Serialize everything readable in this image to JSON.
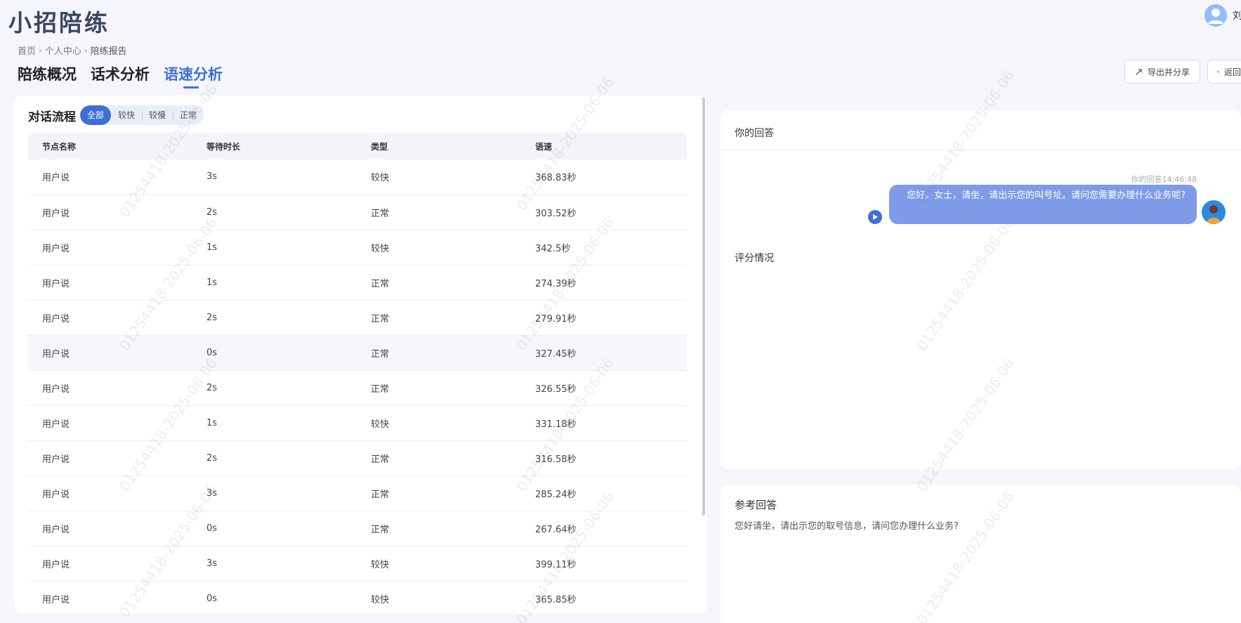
{
  "app": {
    "title": "小招陪练",
    "user_name": "刘"
  },
  "breadcrumb": {
    "items": [
      "首页",
      "个人中心",
      "陪练报告"
    ],
    "separator": "›"
  },
  "tabs": [
    {
      "label": "陪练概况"
    },
    {
      "label": "话术分析"
    },
    {
      "label": "语速分析"
    }
  ],
  "actions": {
    "export_label": "导出并分享",
    "back_label": "返回"
  },
  "left": {
    "title": "对话流程",
    "filters": [
      "全部",
      "较快",
      "较慢",
      "正常"
    ],
    "columns": [
      "节点名称",
      "等待时长",
      "类型",
      "语速"
    ],
    "rows": [
      [
        "用户说",
        "3s",
        "较快",
        "368.83秒"
      ],
      [
        "用户说",
        "2s",
        "正常",
        "303.52秒"
      ],
      [
        "用户说",
        "1s",
        "较快",
        "342.5秒"
      ],
      [
        "用户说",
        "1s",
        "正常",
        "274.39秒"
      ],
      [
        "用户说",
        "2s",
        "正常",
        "279.91秒"
      ],
      [
        "用户说",
        "0s",
        "正常",
        "327.45秒"
      ],
      [
        "用户说",
        "2s",
        "正常",
        "326.55秒"
      ],
      [
        "用户说",
        "1s",
        "较快",
        "331.18秒"
      ],
      [
        "用户说",
        "2s",
        "正常",
        "316.58秒"
      ],
      [
        "用户说",
        "3s",
        "正常",
        "285.24秒"
      ],
      [
        "用户说",
        "0s",
        "正常",
        "267.64秒"
      ],
      [
        "用户说",
        "3s",
        "较快",
        "399.11秒"
      ],
      [
        "用户说",
        "0s",
        "较快",
        "365.85秒"
      ]
    ]
  },
  "answer": {
    "title": "你的回答",
    "time_label": "你的回答14:46:48",
    "message": "您好。女士，请坐，请出示您的叫号址。请问您需要办理什么业务呢?",
    "score_label": "评分情况"
  },
  "reference": {
    "title": "参考回答",
    "text": "您好请坐，请出示您的取号信息，请问您办理什么业务?"
  },
  "watermark": "01254418-2025-06-06",
  "colors": {
    "accent": "#3d6fd8",
    "bubble": "#7d9be8",
    "page_bg": "#f5f6fb"
  }
}
